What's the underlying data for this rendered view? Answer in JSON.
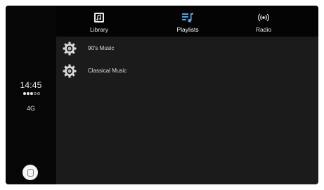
{
  "status": {
    "time": "14:45",
    "network": "4G",
    "signal_bars_filled": 3,
    "signal_bars_total": 5
  },
  "tabs": [
    {
      "label": "Library",
      "icon": "library-icon",
      "active": false
    },
    {
      "label": "Playlists",
      "icon": "playlists-icon",
      "active": true
    },
    {
      "label": "Radio",
      "icon": "radio-icon",
      "active": false
    }
  ],
  "list": {
    "items": [
      {
        "label": "90's Music",
        "icon": "gear-icon"
      },
      {
        "label": "Classical Music",
        "icon": "gear-icon"
      }
    ]
  },
  "colors": {
    "accent": "#49a7e6",
    "background": "#1b1b1b",
    "sidebar": "#060606"
  }
}
